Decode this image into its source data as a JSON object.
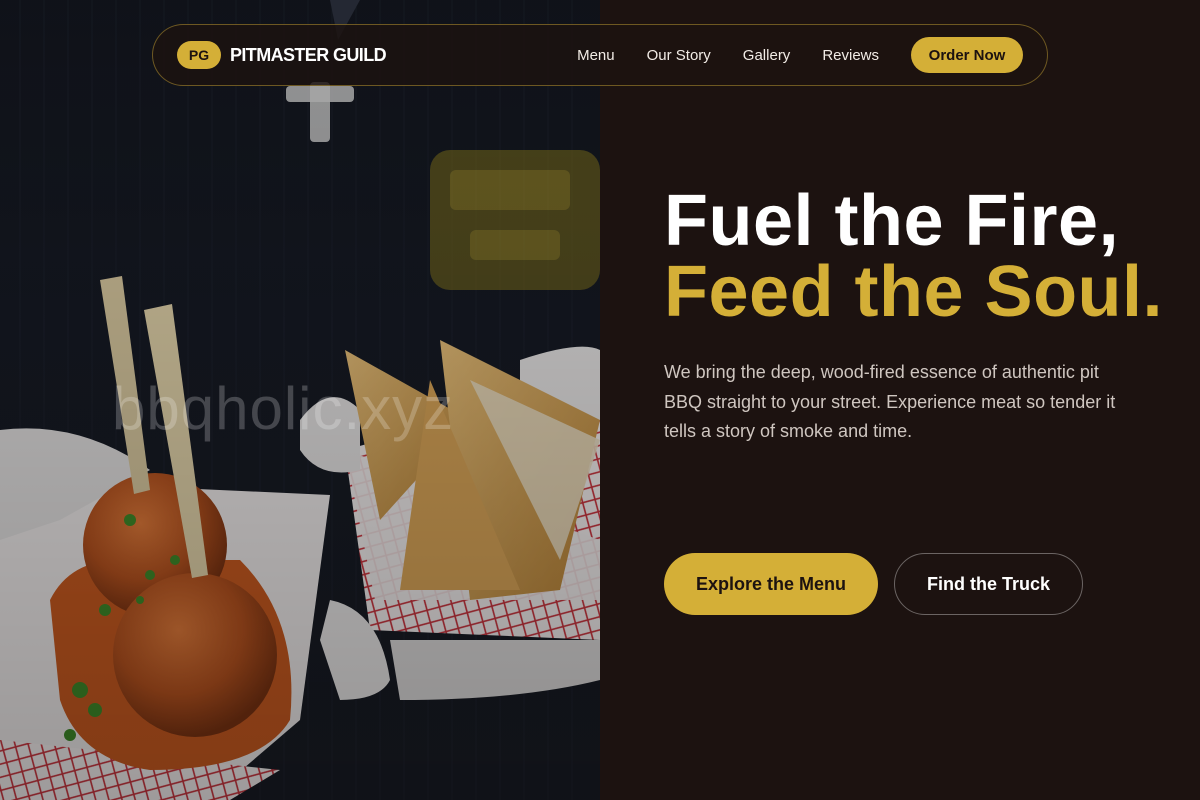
{
  "brand": {
    "badge": "PG",
    "name": "PITMASTER GUILD",
    "accent_color": "#d4af37",
    "background_color": "#1c1210"
  },
  "nav": {
    "links": [
      "Menu",
      "Our Story",
      "Gallery",
      "Reviews"
    ],
    "cta": "Order Now"
  },
  "hero": {
    "headline_line1": "Fuel the Fire,",
    "headline_line2": "Feed the Soul.",
    "lede": "We bring the deep, wood-fired essence of authentic pit BBQ straight to your street. Experience meat so tender it tells a story of smoke and time.",
    "primary_cta": "Explore the Menu",
    "secondary_cta": "Find the Truck"
  },
  "photo": {
    "watermark": "bbqholic.xyz"
  }
}
